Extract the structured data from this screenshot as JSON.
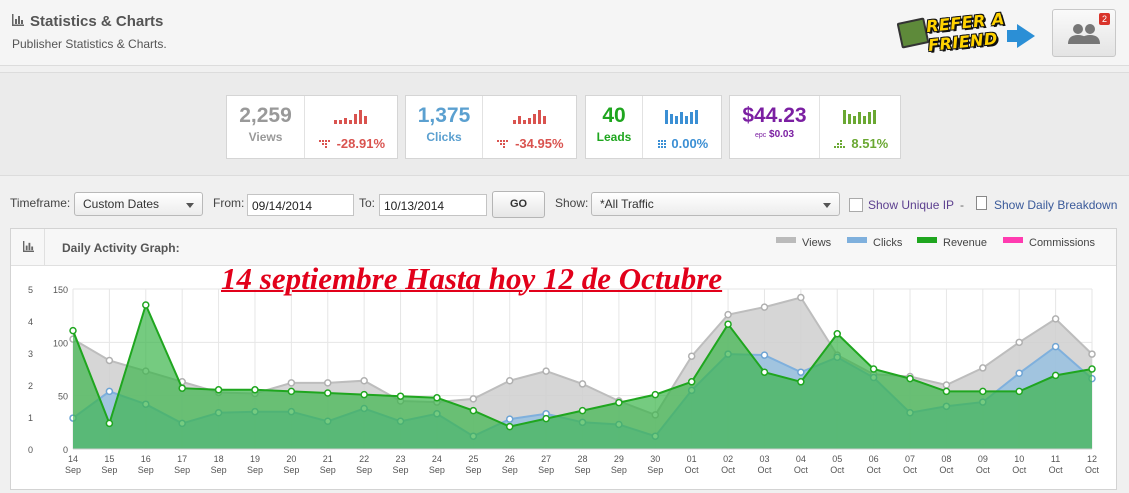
{
  "header": {
    "title": "Statistics & Charts",
    "subtitle": "Publisher Statistics & Charts.",
    "icon": "bar-chart-icon",
    "refer_logo_text": "REFER A FRIEND",
    "notifications_badge": "2"
  },
  "stats": [
    {
      "value": "2,259",
      "label": "Views",
      "change": "-28.91%",
      "color": "#999999",
      "change_color": "#d9534f"
    },
    {
      "value": "1,375",
      "label": "Clicks",
      "change": "-34.95%",
      "color": "#5ba0d0",
      "change_color": "#d9534f"
    },
    {
      "value": "40",
      "label": "Leads",
      "change": "0.00%",
      "color": "#1fa61f",
      "change_color": "#3b8fd4"
    },
    {
      "value": "$44.23",
      "label": "",
      "epc_label": "epc",
      "epc_value": "$0.03",
      "change": "8.51%",
      "color": "#7b1fa2",
      "change_color": "#6aa832"
    }
  ],
  "filters": {
    "timeframe_label": "Timeframe:",
    "timeframe_value": "Custom Dates",
    "from_label": "From:",
    "from_value": "09/14/2014",
    "to_label": "To:",
    "to_value": "10/13/2014",
    "go_label": "GO",
    "show_label": "Show:",
    "show_value": "*All Traffic",
    "unique_ip_label": "Show Unique IP",
    "separator": "-",
    "daily_breakdown_label": "Show Daily Breakdown"
  },
  "graph": {
    "title": "Daily Activity Graph:",
    "overlay_text": "14 septiembre Hasta hoy 12 de Octubre",
    "legend": [
      {
        "name": "Views",
        "color": "#bbbbbb"
      },
      {
        "name": "Clicks",
        "color": "#7fb0dd"
      },
      {
        "name": "Revenue",
        "color": "#1fa61f"
      },
      {
        "name": "Commissions",
        "color": "#ff3bb0"
      }
    ]
  },
  "chart_data": {
    "type": "area",
    "x": [
      "14 Sep",
      "15 Sep",
      "16 Sep",
      "17 Sep",
      "18 Sep",
      "19 Sep",
      "20 Sep",
      "21 Sep",
      "22 Sep",
      "23 Sep",
      "24 Sep",
      "25 Sep",
      "26 Sep",
      "27 Sep",
      "28 Sep",
      "29 Sep",
      "30 Sep",
      "01 Oct",
      "02 Oct",
      "03 Oct",
      "04 Oct",
      "05 Oct",
      "06 Oct",
      "07 Oct",
      "08 Oct",
      "09 Oct",
      "10 Oct",
      "11 Oct",
      "12 Oct"
    ],
    "x_day": [
      "14",
      "15",
      "16",
      "17",
      "18",
      "19",
      "20",
      "21",
      "22",
      "23",
      "24",
      "25",
      "26",
      "27",
      "28",
      "29",
      "30",
      "01",
      "02",
      "03",
      "04",
      "05",
      "06",
      "07",
      "08",
      "09",
      "10",
      "11",
      "12"
    ],
    "x_month": [
      "Sep",
      "Sep",
      "Sep",
      "Sep",
      "Sep",
      "Sep",
      "Sep",
      "Sep",
      "Sep",
      "Sep",
      "Sep",
      "Sep",
      "Sep",
      "Sep",
      "Sep",
      "Sep",
      "Sep",
      "Oct",
      "Oct",
      "Oct",
      "Oct",
      "Oct",
      "Oct",
      "Oct",
      "Oct",
      "Oct",
      "Oct",
      "Oct",
      "Oct"
    ],
    "left_axis_ticks": [
      0,
      1,
      2,
      3,
      4,
      5
    ],
    "left_axis_ticks_positions": [
      0,
      1,
      2,
      3,
      4,
      5
    ],
    "right_axis_ticks": [
      0,
      50,
      100,
      150
    ],
    "ylim_left": [
      0,
      5
    ],
    "ylim_right": [
      0,
      150
    ],
    "grid": true,
    "series": [
      {
        "name": "Views",
        "axis": "right",
        "color": "#bbbbbb",
        "values": [
          103,
          83,
          73,
          63,
          53,
          52,
          62,
          62,
          64,
          45,
          44,
          47,
          64,
          73,
          61,
          45,
          32,
          87,
          126,
          133,
          142,
          88,
          70,
          68,
          60,
          76,
          100,
          122,
          89
        ]
      },
      {
        "name": "Clicks",
        "axis": "right",
        "color": "#7fb0dd",
        "values": [
          29,
          54,
          42,
          24,
          34,
          35,
          35,
          26,
          38,
          26,
          33,
          12,
          28,
          33,
          25,
          23,
          12,
          55,
          89,
          88,
          72,
          86,
          67,
          34,
          40,
          44,
          71,
          96,
          66
        ]
      },
      {
        "name": "Revenue",
        "axis": "left",
        "color": "#1fa61f",
        "values": [
          3.7,
          0.8,
          4.5,
          1.9,
          1.85,
          1.85,
          1.8,
          1.75,
          1.7,
          1.65,
          1.6,
          1.2,
          0.7,
          0.95,
          1.2,
          1.45,
          1.7,
          2.1,
          3.9,
          2.4,
          2.1,
          3.6,
          2.5,
          2.2,
          1.8,
          1.8,
          1.8,
          2.3,
          2.5
        ]
      },
      {
        "name": "Commissions",
        "axis": "left",
        "color": "#ff3bb0",
        "values": []
      }
    ]
  }
}
